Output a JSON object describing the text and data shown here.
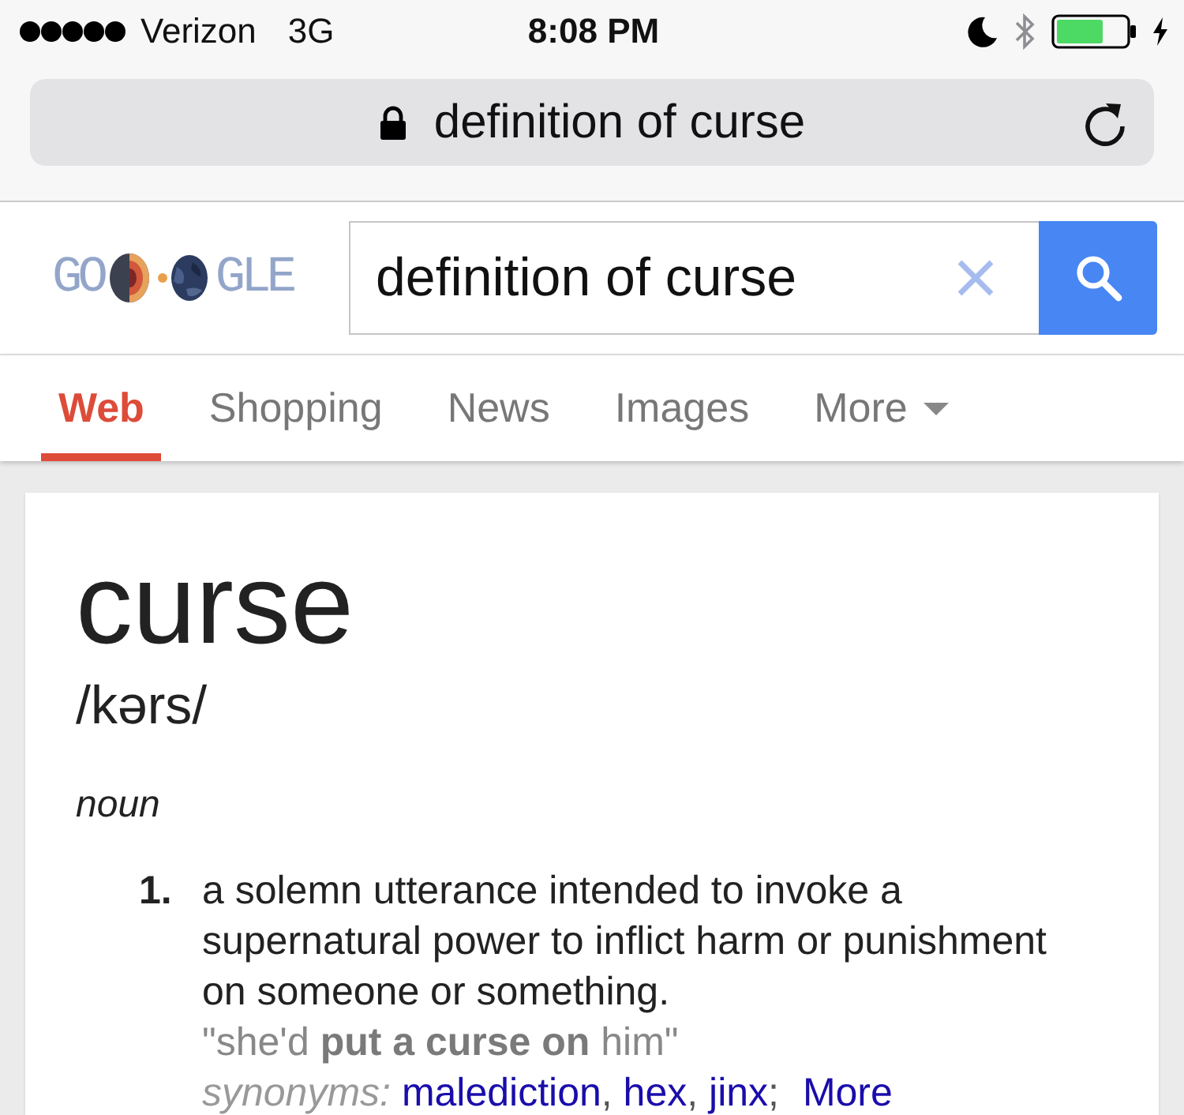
{
  "status_bar": {
    "carrier": "Verizon",
    "network": "3G",
    "time": "8:08 PM"
  },
  "address_bar": {
    "url": "definition of curse",
    "secure": true
  },
  "search": {
    "logo": {
      "left": "GO",
      "right": "GLE"
    },
    "query": "definition of curse"
  },
  "tabs": [
    {
      "label": "Web",
      "selected": true,
      "kind": "tab"
    },
    {
      "label": "Shopping",
      "selected": false,
      "kind": "tab"
    },
    {
      "label": "News",
      "selected": false,
      "kind": "tab"
    },
    {
      "label": "Images",
      "selected": false,
      "kind": "tab"
    },
    {
      "label": "More",
      "selected": false,
      "kind": "menu"
    }
  ],
  "definition": {
    "word": "curse",
    "pronunciation": "/kərs/",
    "part_of_speech": "noun",
    "senses": [
      {
        "number": "1.",
        "text": "a solemn utterance intended to invoke a supernatural power to inflict harm or punishment on someone or something.",
        "example": "\"she'd **put a curse on** him\"",
        "synonyms_label": "synonyms:",
        "synonyms": [
          {
            "word": "malediction",
            "separator": ","
          },
          {
            "word": "hex",
            "separator": ","
          },
          {
            "word": "jinx",
            "separator": ";"
          }
        ],
        "more": "More"
      }
    ]
  }
}
